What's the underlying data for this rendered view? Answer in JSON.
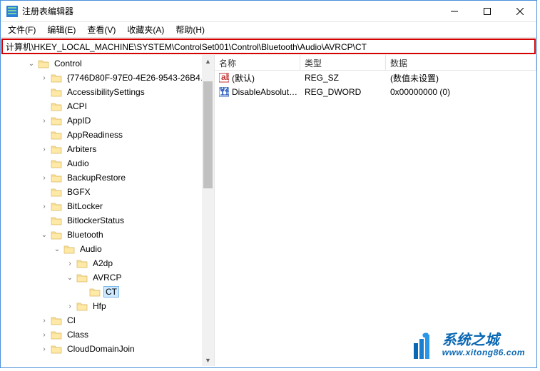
{
  "window": {
    "title": "注册表编辑器"
  },
  "menu": {
    "file": "文件(F)",
    "edit": "编辑(E)",
    "view": "查看(V)",
    "favorites": "收藏夹(A)",
    "help": "帮助(H)"
  },
  "address": {
    "path": "计算机\\HKEY_LOCAL_MACHINE\\SYSTEM\\ControlSet001\\Control\\Bluetooth\\Audio\\AVRCP\\CT"
  },
  "columns": {
    "name": "名称",
    "type": "类型",
    "data": "数据"
  },
  "tree": [
    {
      "level": 2,
      "exp": "open",
      "label": "Control"
    },
    {
      "level": 3,
      "exp": "closed",
      "label": "{7746D80F-97E0-4E26-9543-26B4…"
    },
    {
      "level": 3,
      "exp": "none",
      "label": "AccessibilitySettings"
    },
    {
      "level": 3,
      "exp": "none",
      "label": "ACPI"
    },
    {
      "level": 3,
      "exp": "closed",
      "label": "AppID"
    },
    {
      "level": 3,
      "exp": "none",
      "label": "AppReadiness"
    },
    {
      "level": 3,
      "exp": "closed",
      "label": "Arbiters"
    },
    {
      "level": 3,
      "exp": "none",
      "label": "Audio"
    },
    {
      "level": 3,
      "exp": "closed",
      "label": "BackupRestore"
    },
    {
      "level": 3,
      "exp": "none",
      "label": "BGFX"
    },
    {
      "level": 3,
      "exp": "closed",
      "label": "BitLocker"
    },
    {
      "level": 3,
      "exp": "none",
      "label": "BitlockerStatus"
    },
    {
      "level": 3,
      "exp": "open",
      "label": "Bluetooth"
    },
    {
      "level": 4,
      "exp": "open",
      "label": "Audio"
    },
    {
      "level": 5,
      "exp": "closed",
      "label": "A2dp"
    },
    {
      "level": 5,
      "exp": "open",
      "label": "AVRCP"
    },
    {
      "level": 6,
      "exp": "none",
      "label": "CT",
      "selected": true
    },
    {
      "level": 5,
      "exp": "closed",
      "label": "Hfp"
    },
    {
      "level": 3,
      "exp": "closed",
      "label": "CI"
    },
    {
      "level": 3,
      "exp": "closed",
      "label": "Class"
    },
    {
      "level": 3,
      "exp": "closed",
      "label": "CloudDomainJoin"
    }
  ],
  "values": [
    {
      "icon": "sz",
      "name": "(默认)",
      "type": "REG_SZ",
      "data": "(数值未设置)"
    },
    {
      "icon": "dw",
      "name": "DisableAbsolut…",
      "type": "REG_DWORD",
      "data": "0x00000000 (0)"
    }
  ],
  "watermark": {
    "cn": "系统之城",
    "url": "www.xitong86.com"
  }
}
